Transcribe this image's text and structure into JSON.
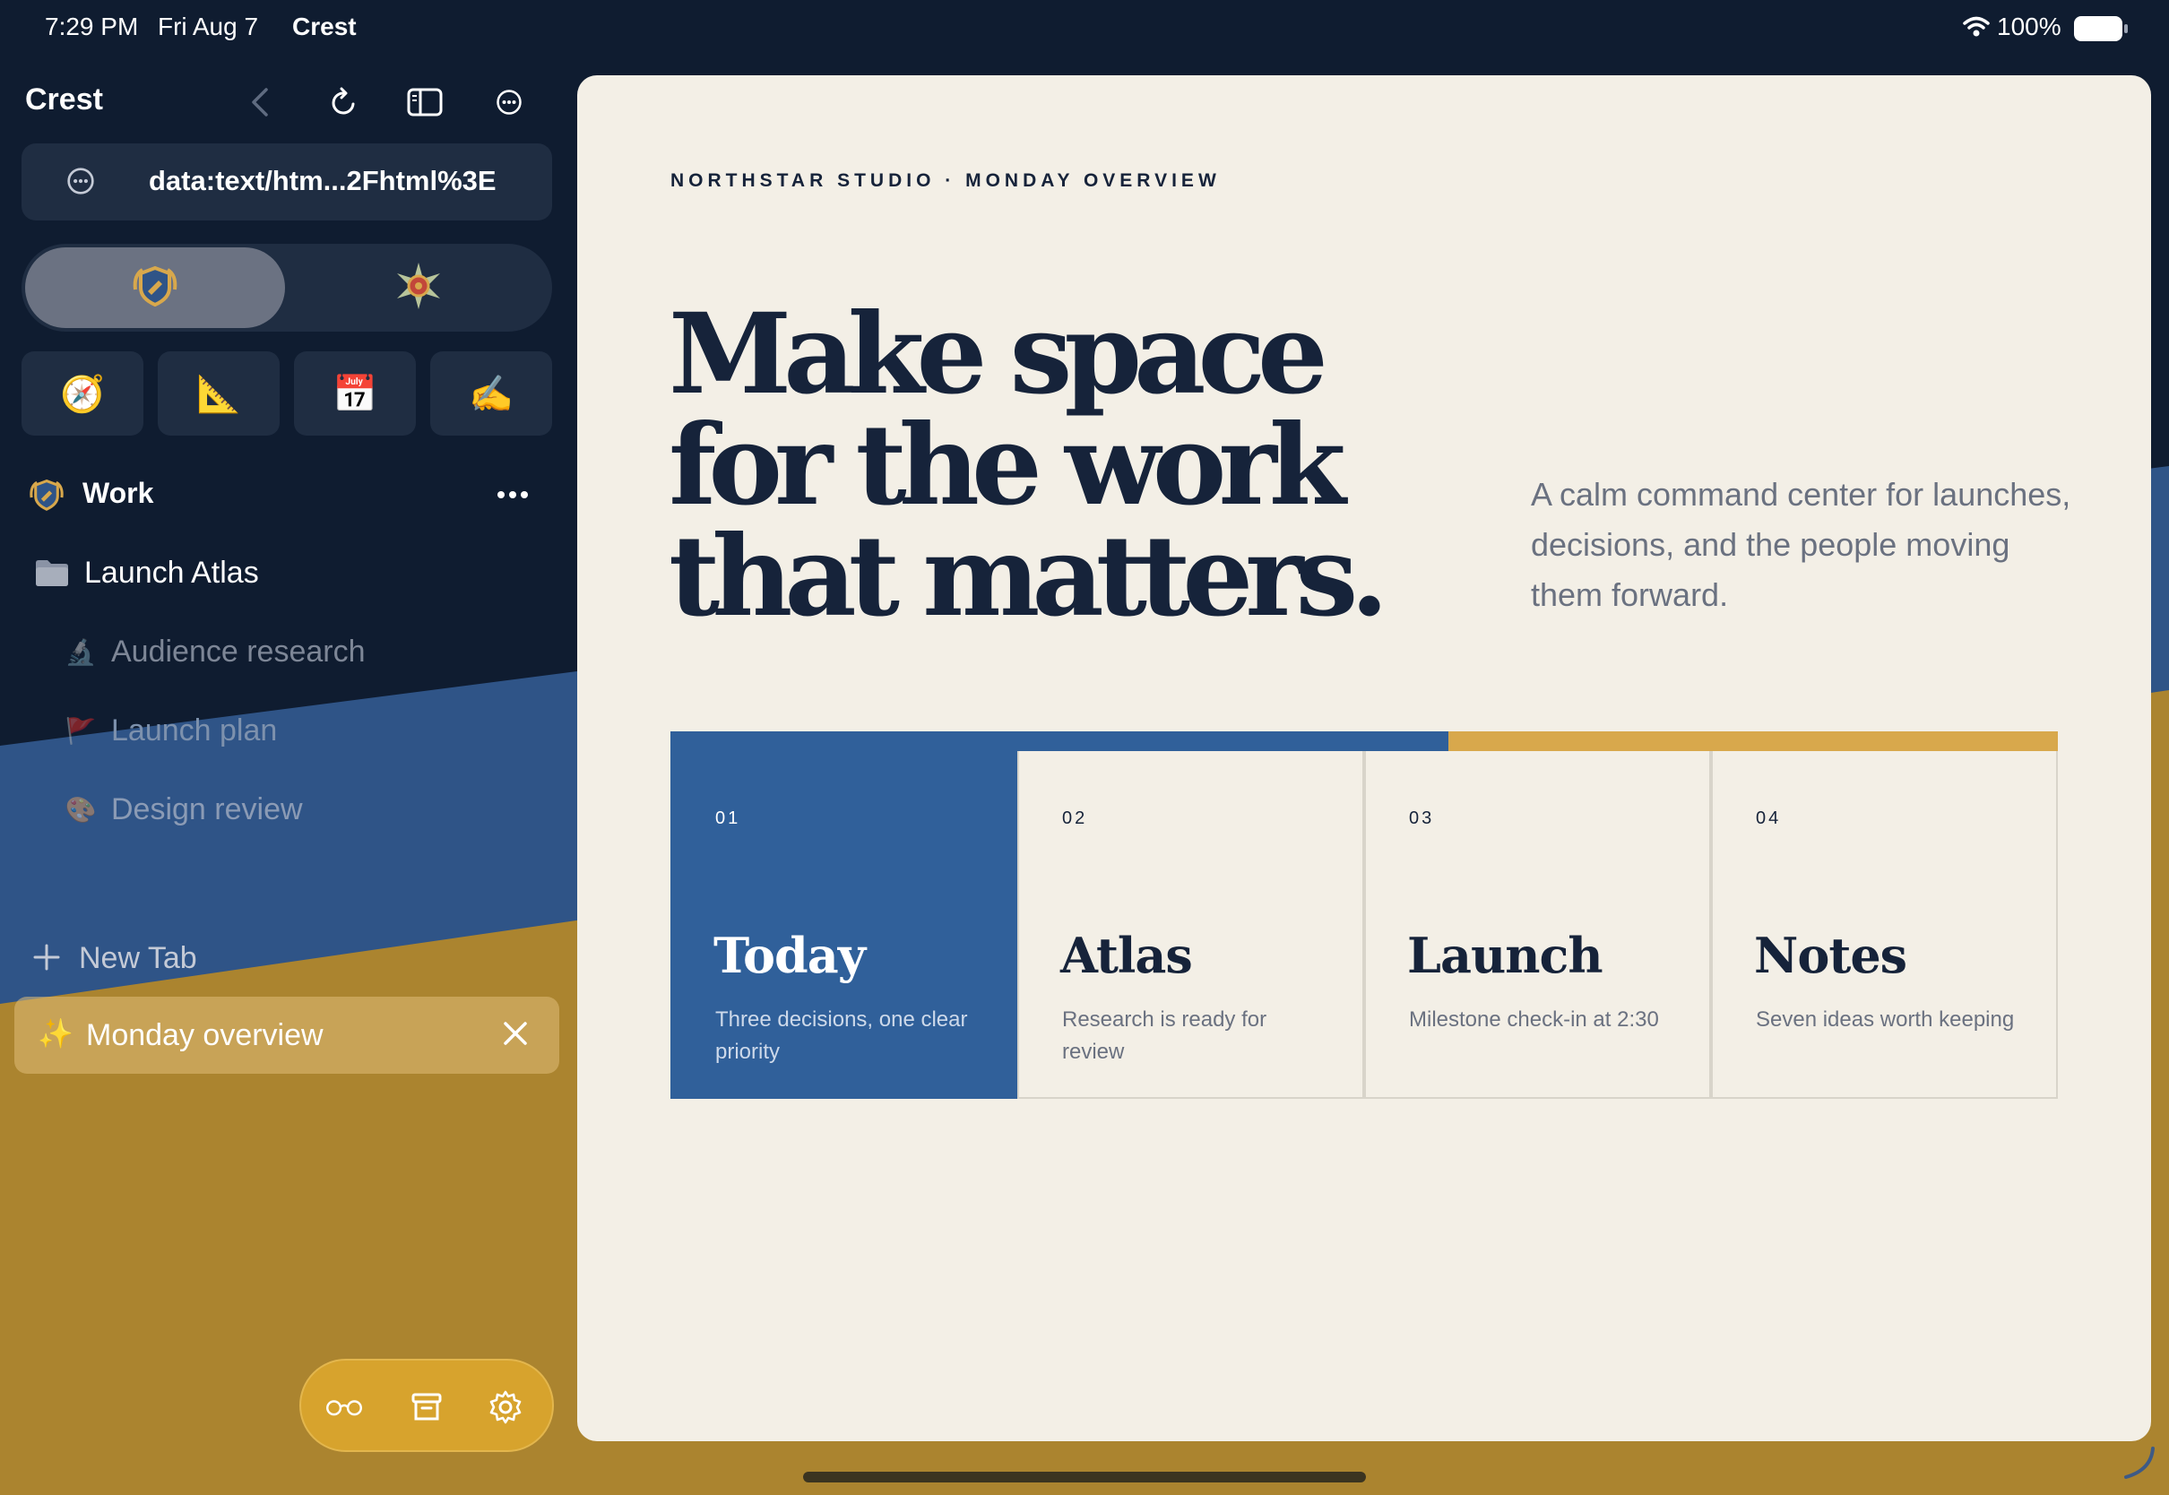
{
  "status_bar": {
    "time": "7:29 PM",
    "date": "Fri Aug 7",
    "app_name": "Crest",
    "battery": "100%"
  },
  "sidebar": {
    "title": "Crest",
    "url": "data:text/htm...2Fhtml%3E",
    "profiles": [
      {
        "icon": "shield-badge-icon"
      },
      {
        "icon": "compass-rose-badge-icon"
      }
    ],
    "favorites": [
      {
        "glyph": "🧭",
        "icon": "compass-icon"
      },
      {
        "glyph": "📐",
        "icon": "triangle-ruler-icon"
      },
      {
        "glyph": "📅",
        "icon": "calendar-icon"
      },
      {
        "glyph": "✍️",
        "icon": "writing-hand-icon"
      }
    ],
    "space": {
      "label": "Work"
    },
    "folder": {
      "label": "Launch Atlas"
    },
    "tabs": [
      {
        "glyph": "🔬",
        "label": "Audience research"
      },
      {
        "glyph": "🚩",
        "label": "Launch plan"
      },
      {
        "glyph": "🎨",
        "label": "Design review"
      }
    ],
    "new_tab": "New Tab",
    "active_tab": {
      "glyph": "✨",
      "label": "Monday overview"
    }
  },
  "page": {
    "eyebrow": "NORTHSTAR STUDIO · MONDAY OVERVIEW",
    "headline": "Make space for the work that matters.",
    "lede": "A calm command center for launches, decisions, and the people moving them forward.",
    "cards": [
      {
        "num": "01",
        "title": "Today",
        "desc": "Three decisions, one clear priority"
      },
      {
        "num": "02",
        "title": "Atlas",
        "desc": "Research is ready for review"
      },
      {
        "num": "03",
        "title": "Launch",
        "desc": "Milestone check-in at 2:30"
      },
      {
        "num": "04",
        "title": "Notes",
        "desc": "Seven ideas worth keeping"
      }
    ]
  },
  "colors": {
    "navy": "#0f1c30",
    "blue": "#30609a",
    "gold": "#d8a84c",
    "paper": "#f3efe6"
  }
}
